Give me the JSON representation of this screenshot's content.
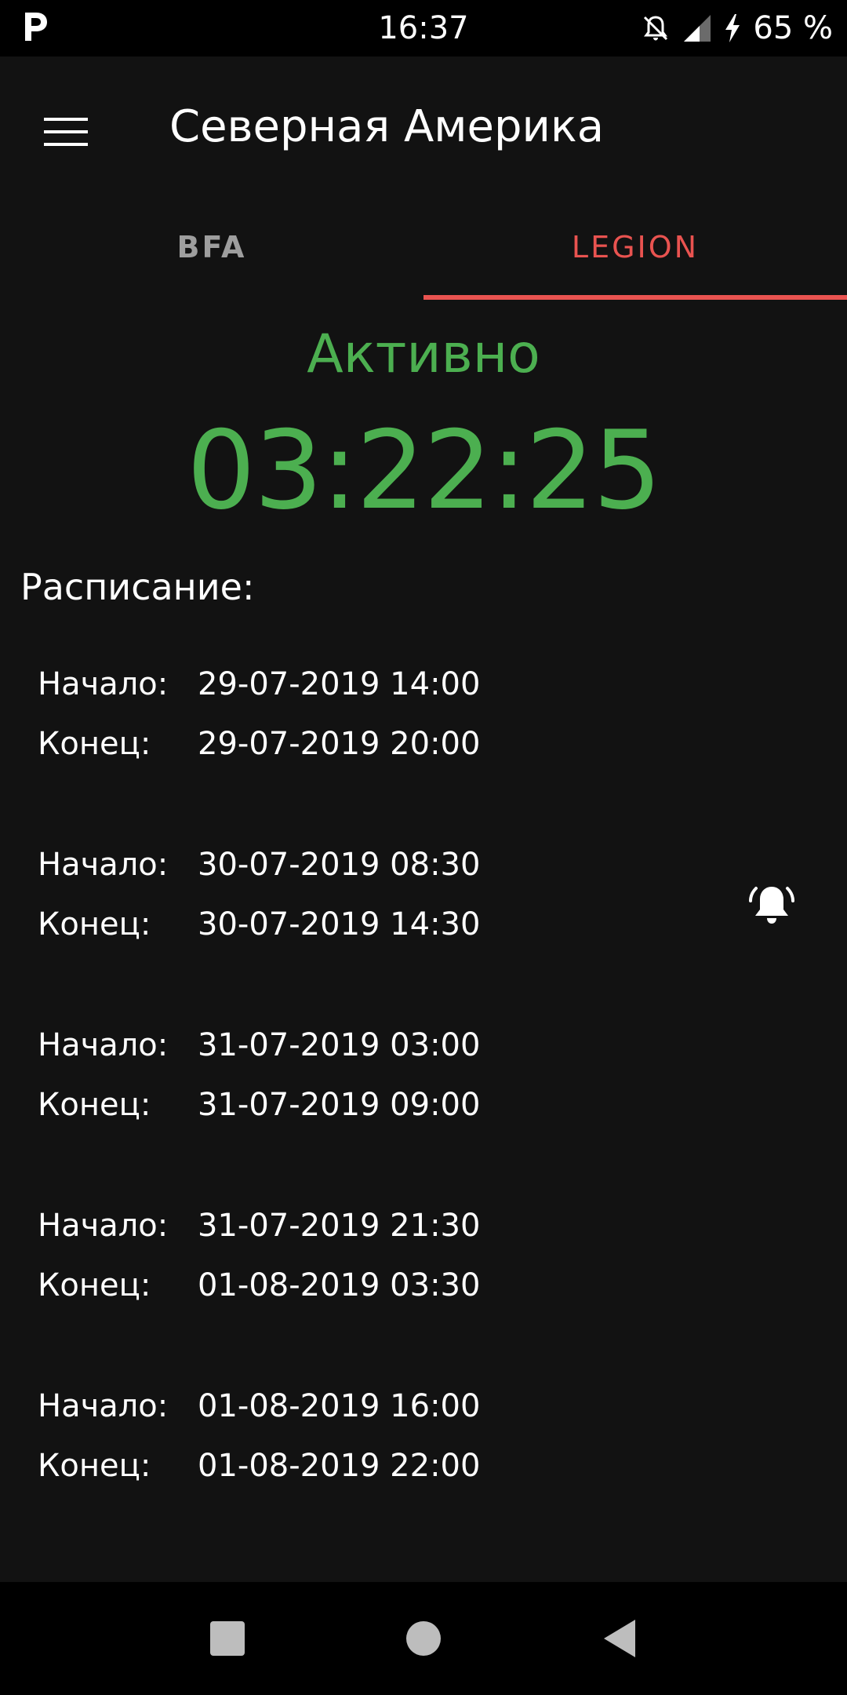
{
  "status_bar": {
    "time": "16:37",
    "battery": "65 %",
    "left_icon": "parking-app-icon",
    "right_icons": [
      "notifications-off-icon",
      "signal-icon",
      "charging-icon"
    ]
  },
  "app_bar": {
    "title": "Северная Америка",
    "menu_icon": "hamburger-menu-icon"
  },
  "tabs": [
    {
      "label": "BFA",
      "selected": false
    },
    {
      "label": "LEGION",
      "selected": true
    }
  ],
  "event": {
    "status": "Активно",
    "countdown": "03:22:25"
  },
  "schedule": {
    "heading": "Расписание:",
    "start_label": "Начало:",
    "end_label": "Конец:",
    "entries": [
      {
        "start": "29-07-2019 14:00",
        "end": "29-07-2019 20:00"
      },
      {
        "start": "30-07-2019 08:30",
        "end": "30-07-2019 14:30",
        "alarm_icon": "alarm-bell-icon"
      },
      {
        "start": "31-07-2019 03:00",
        "end": "31-07-2019 09:00"
      },
      {
        "start": "31-07-2019 21:30",
        "end": "01-08-2019 03:30"
      },
      {
        "start": "01-08-2019 16:00",
        "end": "01-08-2019 22:00"
      }
    ]
  },
  "colors": {
    "accent": "#e95350",
    "active_green": "#4caf50",
    "background": "#121212",
    "tab_inactive": "#9e9e9e"
  },
  "nav_bar": {
    "buttons": [
      "recents-square-icon",
      "home-circle-icon",
      "back-triangle-icon"
    ]
  }
}
